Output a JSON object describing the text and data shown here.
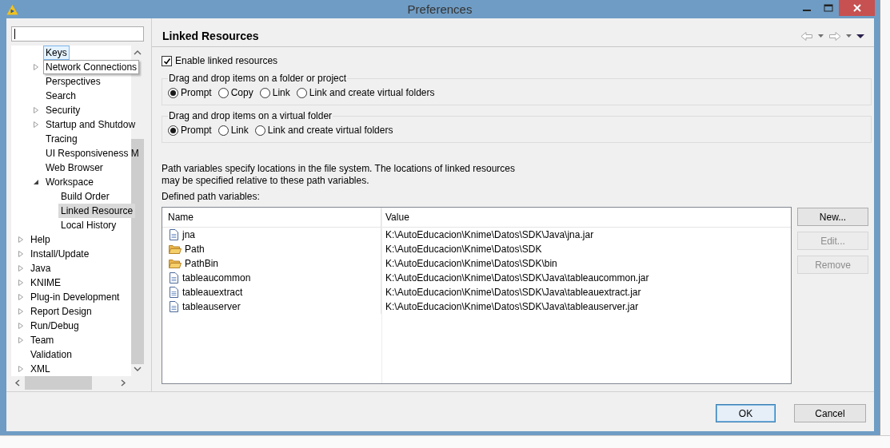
{
  "window": {
    "title": "Preferences"
  },
  "tree": {
    "general_children": [
      {
        "label": "Keys",
        "selected": false,
        "hovered": true,
        "tooltip": false
      },
      {
        "label": "Network Connections",
        "selected": false,
        "hovered": false,
        "tooltip": true,
        "expanded": false
      },
      {
        "label": "Perspectives",
        "selected": false,
        "hovered": false,
        "tooltip": false
      },
      {
        "label": "Search",
        "selected": false,
        "hovered": false,
        "tooltip": false
      },
      {
        "label": "Security",
        "selected": false,
        "hovered": false,
        "tooltip": false,
        "expanded": false
      },
      {
        "label": "Startup and Shutdow",
        "selected": false,
        "hovered": false,
        "tooltip": false,
        "expanded": false
      },
      {
        "label": "Tracing",
        "selected": false,
        "hovered": false,
        "tooltip": false
      },
      {
        "label": "UI Responsiveness M",
        "selected": false,
        "hovered": false,
        "tooltip": false
      },
      {
        "label": "Web Browser",
        "selected": false,
        "hovered": false,
        "tooltip": false
      },
      {
        "label": "Workspace",
        "selected": false,
        "hovered": false,
        "tooltip": false,
        "expanded": true,
        "children": [
          {
            "label": "Build Order",
            "selected": false,
            "hovered": false,
            "tooltip": false
          },
          {
            "label": "Linked Resource",
            "selected": true,
            "hovered": false,
            "tooltip": false
          },
          {
            "label": "Local History",
            "selected": false,
            "hovered": false,
            "tooltip": false
          }
        ]
      }
    ],
    "items": [
      {
        "label": "Help",
        "selected": false,
        "hovered": false,
        "tooltip": false,
        "expanded": false
      },
      {
        "label": "Install/Update",
        "selected": false,
        "hovered": false,
        "tooltip": false,
        "expanded": false
      },
      {
        "label": "Java",
        "selected": false,
        "hovered": false,
        "tooltip": false,
        "expanded": false
      },
      {
        "label": "KNIME",
        "selected": false,
        "hovered": false,
        "tooltip": false,
        "expanded": false
      },
      {
        "label": "Plug-in Development",
        "selected": false,
        "hovered": false,
        "tooltip": false,
        "expanded": false
      },
      {
        "label": "Report Design",
        "selected": false,
        "hovered": false,
        "tooltip": false,
        "expanded": false
      },
      {
        "label": "Run/Debug",
        "selected": false,
        "hovered": false,
        "tooltip": false,
        "expanded": false
      },
      {
        "label": "Team",
        "selected": false,
        "hovered": false,
        "tooltip": false,
        "expanded": false
      },
      {
        "label": "Validation",
        "selected": false,
        "hovered": false,
        "tooltip": false
      },
      {
        "label": "XML",
        "selected": false,
        "hovered": false,
        "tooltip": false,
        "expanded": false
      }
    ]
  },
  "page": {
    "title": "Linked Resources",
    "enable": {
      "label": "Enable linked resources",
      "checked": true
    },
    "groups": [
      {
        "title": "Drag and drop items on a folder or project",
        "options": [
          {
            "label": "Prompt",
            "selected": true
          },
          {
            "label": "Copy",
            "selected": false
          },
          {
            "label": "Link",
            "selected": false
          },
          {
            "label": "Link and create virtual folders",
            "selected": false
          }
        ]
      },
      {
        "title": "Drag and drop items on a virtual folder",
        "options": [
          {
            "label": "Prompt",
            "selected": true
          },
          {
            "label": "Link",
            "selected": false
          },
          {
            "label": "Link and create virtual folders",
            "selected": false
          }
        ]
      }
    ],
    "description": "Path variables specify locations in the file system. The locations of linked resources may be specified relative to these path variables.",
    "variables_label": "Defined path variables:",
    "table": {
      "columns": [
        "Name",
        "Value"
      ],
      "rows": [
        {
          "kind": "file",
          "name": "jna",
          "value": "K:\\AutoEducacion\\Knime\\Datos\\SDK\\Java\\jna.jar"
        },
        {
          "kind": "folder",
          "name": "Path",
          "value": "K:\\AutoEducacion\\Knime\\Datos\\SDK"
        },
        {
          "kind": "folder",
          "name": "PathBin",
          "value": "K:\\AutoEducacion\\Knime\\Datos\\SDK\\bin"
        },
        {
          "kind": "file",
          "name": "tableaucommon",
          "value": "K:\\AutoEducacion\\Knime\\Datos\\SDK\\Java\\tableaucommon.jar"
        },
        {
          "kind": "file",
          "name": "tableauextract",
          "value": "K:\\AutoEducacion\\Knime\\Datos\\SDK\\Java\\tableauextract.jar"
        },
        {
          "kind": "file",
          "name": "tableauserver",
          "value": "K:\\AutoEducacion\\Knime\\Datos\\SDK\\Java\\tableauserver.jar"
        }
      ]
    },
    "side_buttons": [
      {
        "label": "New...",
        "disabled": false
      },
      {
        "label": "Edit...",
        "disabled": true
      },
      {
        "label": "Remove",
        "disabled": true
      }
    ]
  },
  "buttons": [
    {
      "label": "OK",
      "default": true
    },
    {
      "label": "Cancel",
      "default": false
    }
  ]
}
